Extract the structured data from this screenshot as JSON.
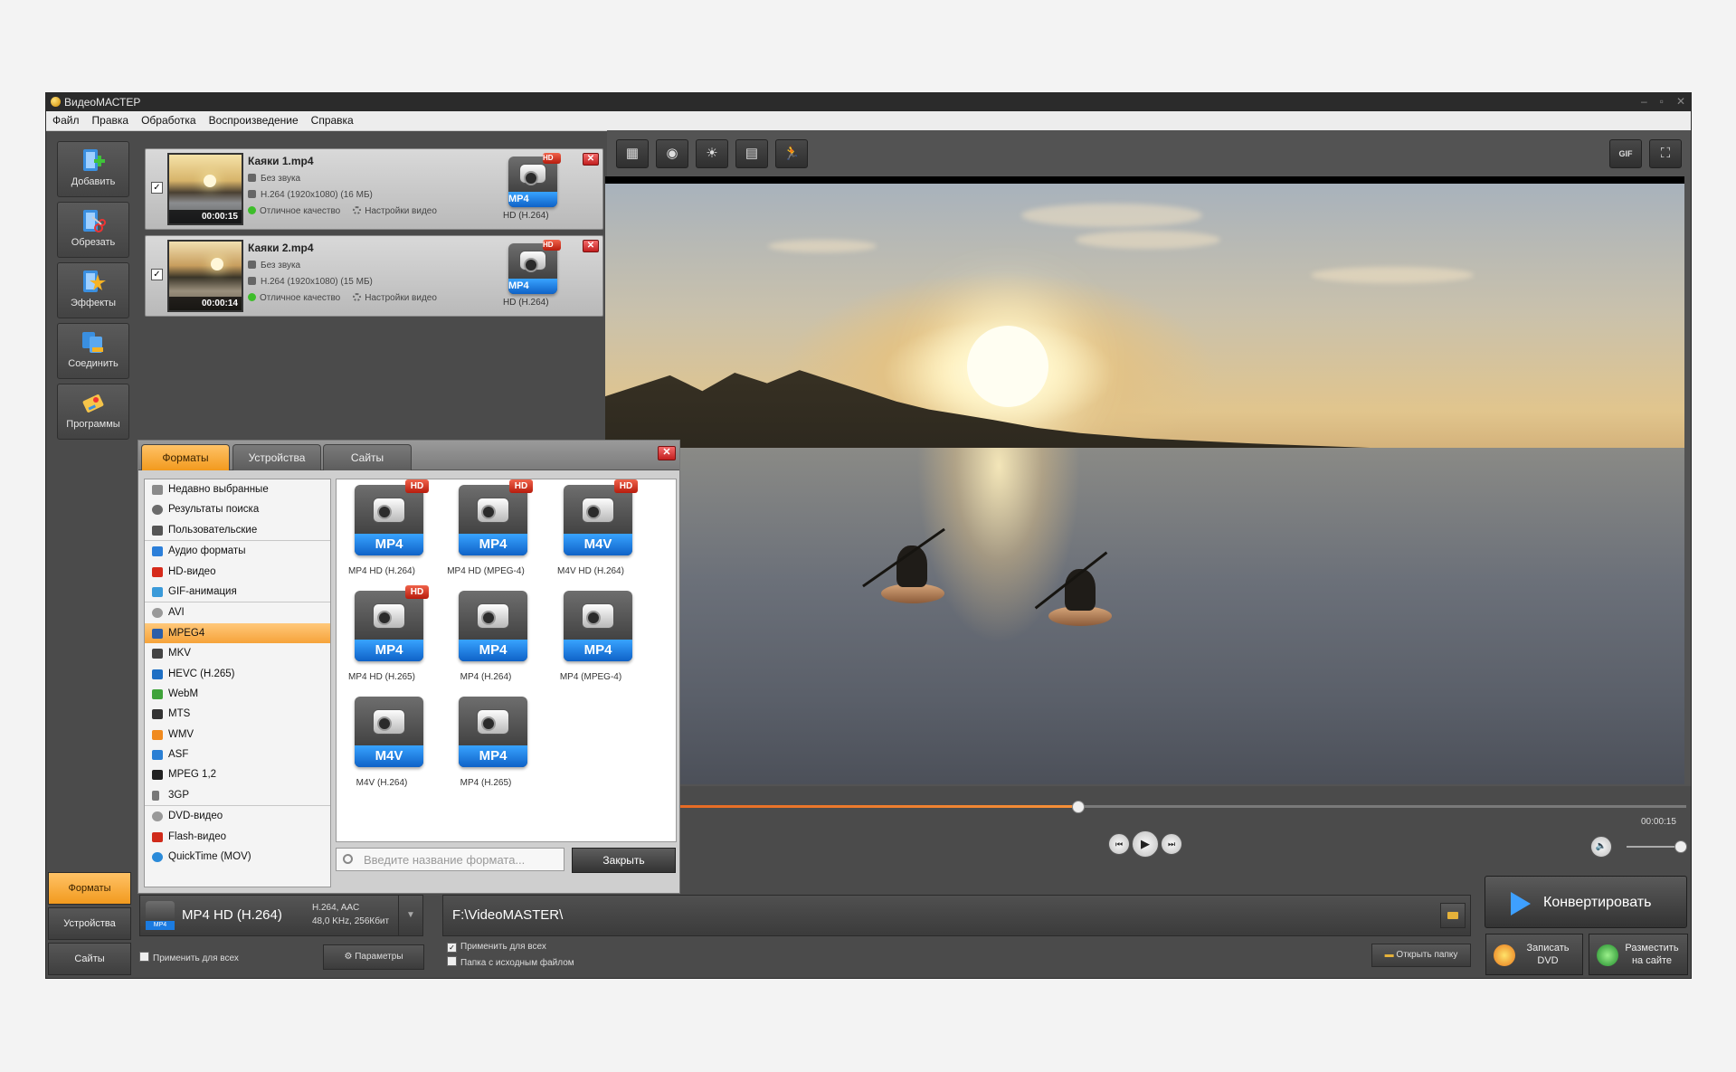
{
  "window": {
    "title": "ВидеоМАСТЕР"
  },
  "menu": [
    "Файл",
    "Правка",
    "Обработка",
    "Воспроизведение",
    "Справка"
  ],
  "tools": [
    "Добавить",
    "Обрезать",
    "Эффекты",
    "Соединить",
    "Программы"
  ],
  "files": [
    {
      "name": "Каяки 1.mp4",
      "duration": "00:00:15",
      "audio": "Без звука",
      "codec": "H.264 (1920x1080) (16 МБ)",
      "quality": "Отличное качество",
      "settings": "Настройки видео",
      "format_badge": "MP4",
      "format_name": "HD (H.264)",
      "checked": "✓"
    },
    {
      "name": "Каяки 2.mp4",
      "duration": "00:00:14",
      "audio": "Без звука",
      "codec": "H.264 (1920x1080) (15 МБ)",
      "quality": "Отличное качество",
      "settings": "Настройки видео",
      "format_badge": "MP4",
      "format_name": "HD (H.264)",
      "checked": "✓"
    }
  ],
  "hd_label": "HD",
  "preview": {
    "gif_label": "GIF",
    "time": "00:00:15",
    "progress": 0.395,
    "volume": 1.0
  },
  "format_panel": {
    "tabs": [
      "Форматы",
      "Устройства",
      "Сайты"
    ],
    "categories": [
      "Недавно выбранные",
      "Результаты поиска",
      "Пользовательские",
      "Аудио форматы",
      "HD-видео",
      "GIF-анимация",
      "AVI",
      "MPEG4",
      "MKV",
      "HEVC (H.265)",
      "WebM",
      "MTS",
      "WMV",
      "ASF",
      "MPEG 1,2",
      "3GP",
      "DVD-видео",
      "Flash-видео",
      "QuickTime (MOV)"
    ],
    "selected_category": "MPEG4",
    "formats": [
      {
        "badge": "MP4",
        "caption": "MP4 HD (H.264)",
        "hd": true
      },
      {
        "badge": "MP4",
        "caption": "MP4 HD (MPEG-4)",
        "hd": true
      },
      {
        "badge": "M4V",
        "caption": "M4V HD (H.264)",
        "hd": true
      },
      {
        "badge": "MP4",
        "caption": "MP4 HD (H.265)",
        "hd": true
      },
      {
        "badge": "MP4",
        "caption": "MP4 (H.264)",
        "hd": false
      },
      {
        "badge": "MP4",
        "caption": "MP4 (MPEG-4)",
        "hd": false
      },
      {
        "badge": "M4V",
        "caption": "M4V (H.264)",
        "hd": false
      },
      {
        "badge": "MP4",
        "caption": "MP4 (H.265)",
        "hd": false
      }
    ],
    "search_placeholder": "Введите название формата...",
    "close_label": "Закрыть"
  },
  "bottom": {
    "tabs": [
      "Форматы",
      "Устройства",
      "Сайты"
    ],
    "format_name": "MP4 HD (H.264)",
    "format_spec1": "H.264, AAC",
    "format_spec2": "48,0 KHz, 256Кбит",
    "apply_all": "Применить для всех",
    "params": "Параметры",
    "path": "F:\\VideoMASTER\\",
    "opt_apply_all": "Применить для всех",
    "opt_source_folder": "Папка с исходным файлом",
    "open_folder": "Открыть папку",
    "convert": "Конвертировать",
    "burn_dvd_1": "Записать",
    "burn_dvd_2": "DVD",
    "publish_1": "Разместить",
    "publish_2": "на сайте"
  }
}
